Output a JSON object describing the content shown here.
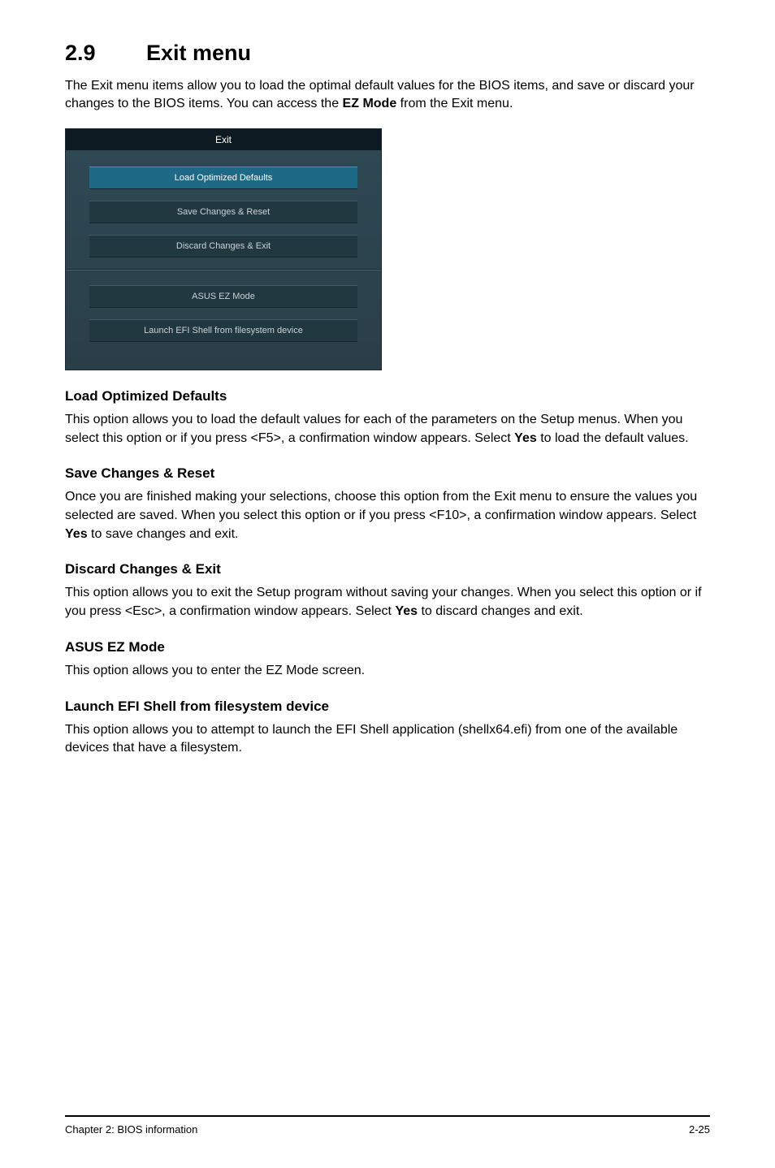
{
  "heading": {
    "num": "2.9",
    "title": "Exit menu"
  },
  "intro": {
    "p1a": "The Exit menu items allow you to load the optimal default values for the BIOS items, and save or discard your changes to the BIOS items. You can access the ",
    "p1b": "EZ Mode",
    "p1c": " from the Exit menu."
  },
  "bios": {
    "tab": "Exit",
    "btn1": "Load Optimized Defaults",
    "btn2": "Save Changes & Reset",
    "btn3": "Discard Changes & Exit",
    "btn4": "ASUS EZ Mode",
    "btn5": "Launch EFI Shell from filesystem device"
  },
  "sections": {
    "s1h": "Load Optimized Defaults",
    "s1a": "This option allows you to load the default values for each of the parameters on the Setup menus. When you select this option or if you press <F5>, a confirmation window appears. Select ",
    "s1b": "Yes",
    "s1c": " to load the default values.",
    "s2h": "Save Changes & Reset",
    "s2a": "Once you are finished making your selections, choose this option from the Exit menu to ensure the values you selected are saved. When you select this option or if you press <F10>, a confirmation window appears. Select ",
    "s2b": "Yes",
    "s2c": " to save changes and exit.",
    "s3h": "Discard Changes & Exit",
    "s3a": "This option allows you to exit the Setup program without saving your changes. When you select this option or if you press <Esc>, a confirmation window appears. Select ",
    "s3b": "Yes",
    "s3c": " to discard changes and exit.",
    "s4h": "ASUS EZ Mode",
    "s4a": "This option allows you to enter the EZ Mode screen.",
    "s5h": "Launch EFI Shell from filesystem device",
    "s5a": "This option allows you to attempt to launch the EFI Shell application (shellx64.efi) from one of the available devices that have a filesystem."
  },
  "footer": {
    "left": "Chapter 2: BIOS information",
    "right": "2-25"
  }
}
